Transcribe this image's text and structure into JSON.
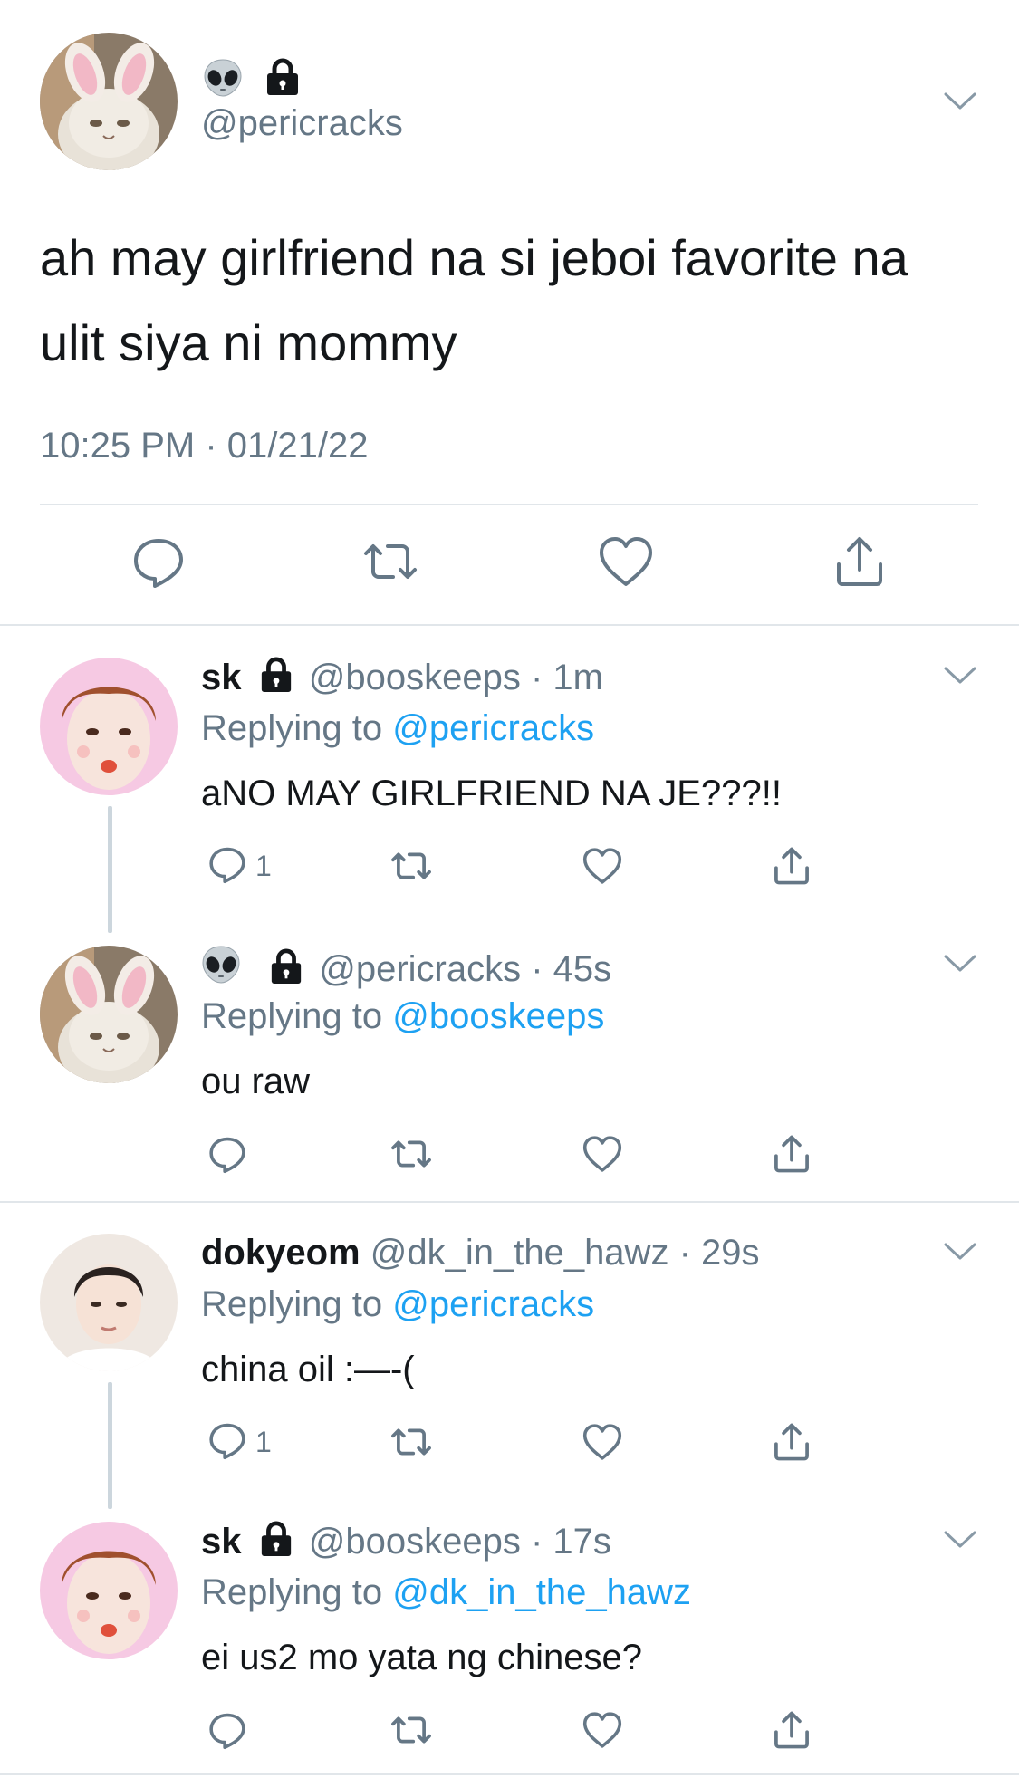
{
  "main_tweet": {
    "avatar": "bunny-ears-cat-avatar",
    "emoji": "alien-emoji",
    "lock": "lock-icon",
    "handle": "@pericracks",
    "text": "ah may girlfriend na si jeboi favorite na ulit siya ni mommy",
    "timestamp": "10:25 PM · 01/21/22",
    "actions": [
      "reply-icon",
      "retweet-icon",
      "like-icon",
      "share-icon"
    ]
  },
  "replies": [
    {
      "name": "sk",
      "handle": "@booskeeps",
      "time": "· 1m",
      "replying_prefix": "Replying to ",
      "replying_to": "@pericracks",
      "text": "aNO MAY GIRLFRIEND NA JE???!!",
      "reply_count": "1"
    },
    {
      "name": "",
      "handle": "@pericracks",
      "time": "· 45s",
      "replying_prefix": "Replying to ",
      "replying_to": "@booskeeps",
      "text": "ou raw",
      "reply_count": ""
    },
    {
      "name": "dokyeom",
      "handle": "@dk_in_the_hawz",
      "time": "· 29s",
      "replying_prefix": "Replying to ",
      "replying_to": "@pericracks",
      "text": "china oil :—-(",
      "reply_count": "1"
    },
    {
      "name": "sk",
      "handle": "@booskeeps",
      "time": "· 17s",
      "replying_prefix": "Replying to ",
      "replying_to": "@dk_in_the_hawz",
      "text": "ei us2 mo yata ng chinese?",
      "reply_count": ""
    }
  ],
  "colors": {
    "text": "#14171a",
    "secondary": "#657786",
    "link": "#1da1f2",
    "divider": "#e1e6ea",
    "thread_line": "#ccd6dd"
  }
}
